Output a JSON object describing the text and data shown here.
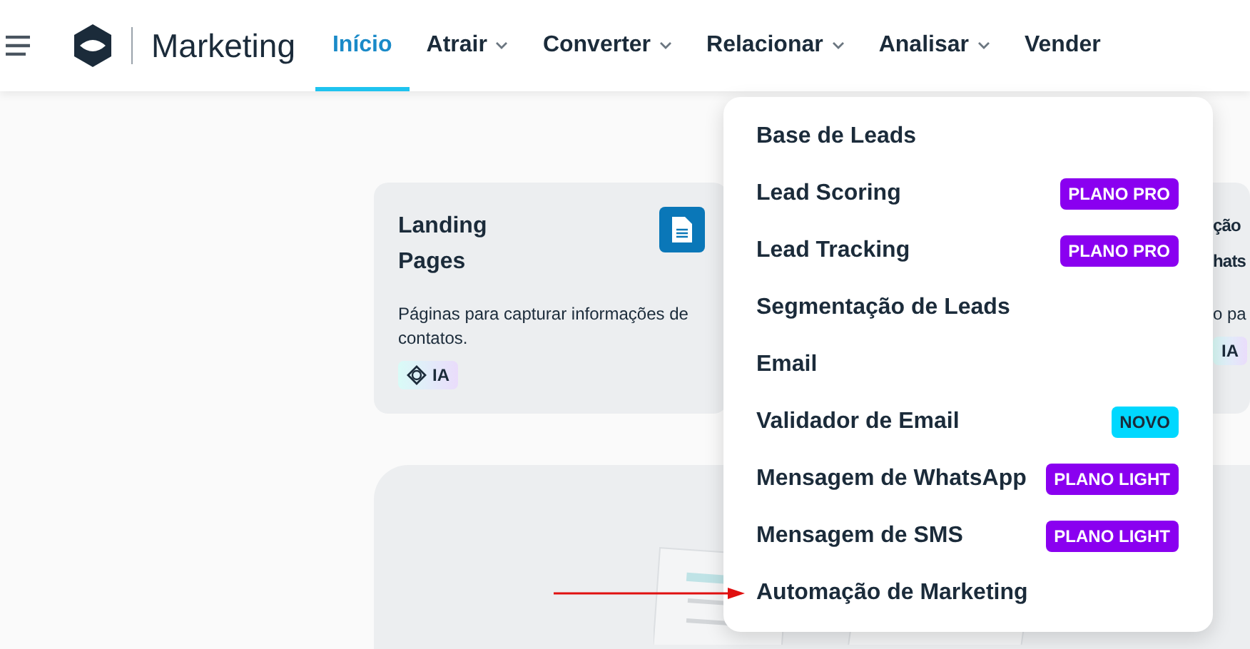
{
  "header": {
    "brand": "Marketing",
    "nav": [
      {
        "label": "Início",
        "selected": true,
        "dropdown": false
      },
      {
        "label": "Atrair",
        "selected": false,
        "dropdown": true
      },
      {
        "label": "Converter",
        "selected": false,
        "dropdown": true
      },
      {
        "label": "Relacionar",
        "selected": false,
        "dropdown": true
      },
      {
        "label": "Analisar",
        "selected": false,
        "dropdown": true
      },
      {
        "label": "Vender",
        "selected": false,
        "dropdown": false
      }
    ]
  },
  "cards": [
    {
      "title_lines": [
        "Landing",
        "Pages"
      ],
      "description": "Páginas para capturar informações de contatos.",
      "badge": "IA"
    },
    {
      "title_lines": [
        "ção",
        "hats"
      ],
      "description": "o pa",
      "badge": "IA"
    }
  ],
  "menu": {
    "items": [
      {
        "label": "Base de Leads"
      },
      {
        "label": "Lead Scoring",
        "badge": {
          "text": "PLANO PRO",
          "color": "#8a00f0"
        }
      },
      {
        "label": "Lead Tracking",
        "badge": {
          "text": "PLANO PRO",
          "color": "#8a00f0"
        }
      },
      {
        "label": "Segmentação de Leads"
      },
      {
        "label": "Email"
      },
      {
        "label": "Validador de Email",
        "badge": {
          "text": "NOVO",
          "color": "#00d8ff"
        }
      },
      {
        "label": "Mensagem de WhatsApp",
        "badge": {
          "text": "PLANO LIGHT",
          "color": "#8a00f0"
        }
      },
      {
        "label": "Mensagem de SMS",
        "badge": {
          "text": "PLANO LIGHT",
          "color": "#8a00f0"
        }
      },
      {
        "label": "Automação de Marketing"
      }
    ]
  }
}
